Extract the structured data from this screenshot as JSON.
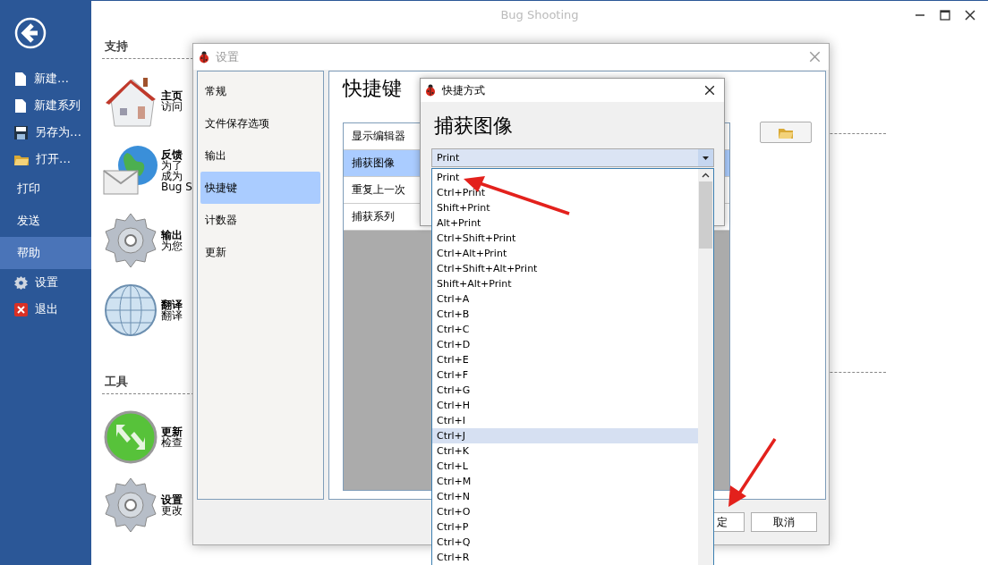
{
  "window": {
    "title": "Bug Shooting"
  },
  "sidebar": {
    "items": [
      {
        "label": "新建…",
        "kind": "file",
        "selected": false
      },
      {
        "label": "新建系列",
        "kind": "file",
        "selected": false
      },
      {
        "label": "另存为…",
        "kind": "save",
        "selected": false
      },
      {
        "label": "打开…",
        "kind": "open",
        "selected": false
      },
      {
        "label": "打印",
        "kind": "plain",
        "selected": false
      },
      {
        "label": "发送",
        "kind": "plain",
        "selected": false
      },
      {
        "label": "帮助",
        "kind": "plain",
        "selected": true
      },
      {
        "label": "设置",
        "kind": "settings",
        "selected": false
      },
      {
        "label": "退出",
        "kind": "exit",
        "selected": false
      }
    ]
  },
  "sections": [
    {
      "heading": "支持",
      "items": [
        {
          "kind": "home",
          "title": "主页",
          "lines": [
            "访问"
          ]
        },
        {
          "kind": "feedback",
          "title": "反馈",
          "lines": [
            "为了",
            "成为",
            "Bug S"
          ]
        },
        {
          "kind": "gear",
          "title": "输出",
          "lines": [
            "为您"
          ]
        },
        {
          "kind": "globe",
          "title": "翻译",
          "lines": [
            "翻译"
          ]
        }
      ]
    },
    {
      "heading": "工具",
      "items": [
        {
          "kind": "update",
          "title": "更新",
          "lines": [
            "检查"
          ]
        },
        {
          "kind": "gear",
          "title": "设置",
          "lines": [
            "更改"
          ]
        }
      ]
    }
  ],
  "settings_dialog": {
    "title": "设置",
    "nav": [
      {
        "label": "常规",
        "selected": false
      },
      {
        "label": "文件保存选项",
        "selected": false
      },
      {
        "label": "输出",
        "selected": false
      },
      {
        "label": "快捷键",
        "selected": true
      },
      {
        "label": "计数器",
        "selected": false
      },
      {
        "label": "更新",
        "selected": false
      }
    ],
    "heading": "快捷键",
    "shortcuts": [
      {
        "label": "显示编辑器",
        "selected": false
      },
      {
        "label": "捕获图像",
        "selected": true
      },
      {
        "label": "重复上一次",
        "selected": false
      },
      {
        "label": "捕获系列",
        "selected": false
      }
    ],
    "buttons": [
      "定",
      "取消"
    ]
  },
  "shortcut_dialog": {
    "title": "快捷方式",
    "heading": "捕获图像",
    "combo": {
      "value": "Print"
    },
    "options": [
      {
        "label": "Print",
        "selected": false
      },
      {
        "label": "Ctrl+Print",
        "selected": false
      },
      {
        "label": "Shift+Print",
        "selected": false
      },
      {
        "label": "Alt+Print",
        "selected": false
      },
      {
        "label": "Ctrl+Shift+Print",
        "selected": false
      },
      {
        "label": "Ctrl+Alt+Print",
        "selected": false
      },
      {
        "label": "Ctrl+Shift+Alt+Print",
        "selected": false
      },
      {
        "label": "Shift+Alt+Print",
        "selected": false
      },
      {
        "label": "Ctrl+A",
        "selected": false
      },
      {
        "label": "Ctrl+B",
        "selected": false
      },
      {
        "label": "Ctrl+C",
        "selected": false
      },
      {
        "label": "Ctrl+D",
        "selected": false
      },
      {
        "label": "Ctrl+E",
        "selected": false
      },
      {
        "label": "Ctrl+F",
        "selected": false
      },
      {
        "label": "Ctrl+G",
        "selected": false
      },
      {
        "label": "Ctrl+H",
        "selected": false
      },
      {
        "label": "Ctrl+I",
        "selected": false
      },
      {
        "label": "Ctrl+J",
        "selected": true
      },
      {
        "label": "Ctrl+K",
        "selected": false
      },
      {
        "label": "Ctrl+L",
        "selected": false
      },
      {
        "label": "Ctrl+M",
        "selected": false
      },
      {
        "label": "Ctrl+N",
        "selected": false
      },
      {
        "label": "Ctrl+O",
        "selected": false
      },
      {
        "label": "Ctrl+P",
        "selected": false
      },
      {
        "label": "Ctrl+Q",
        "selected": false
      },
      {
        "label": "Ctrl+R",
        "selected": false
      }
    ]
  }
}
